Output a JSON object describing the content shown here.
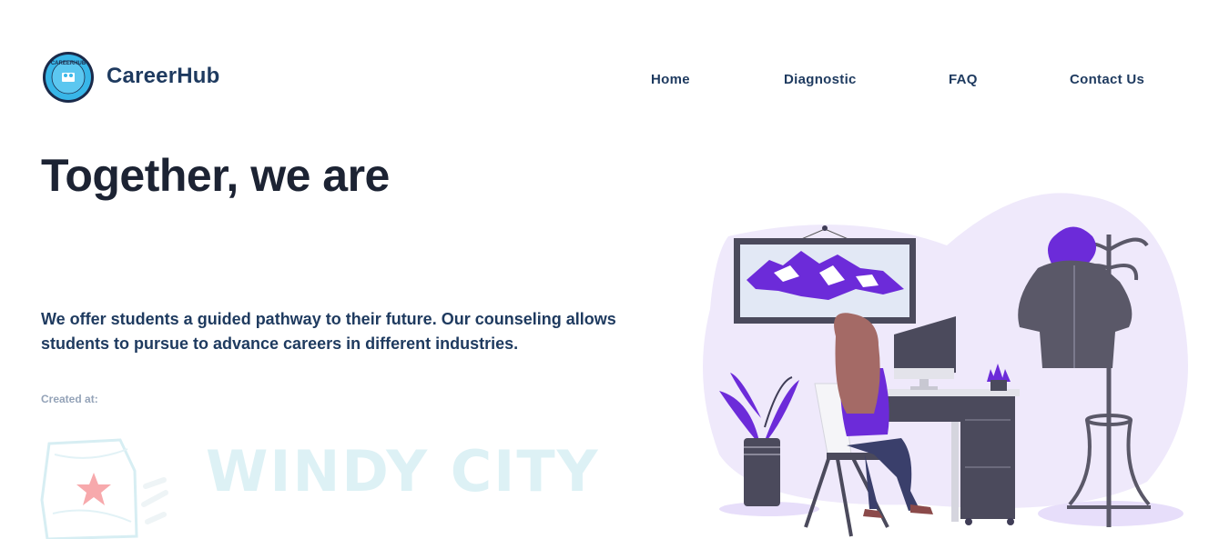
{
  "header": {
    "brand": "CareerHub",
    "logo_text": "CAREERHUB"
  },
  "nav": {
    "items": [
      "Home",
      "Diagnostic",
      "FAQ",
      "Contact Us"
    ]
  },
  "hero": {
    "headline": "Together, we are",
    "description": "We offer students a guided pathway to their future. Our counseling allows students to pursue to advance careers in different industries.",
    "created_label": "Created at:",
    "sponsor_logo_text": "WINDY CITY"
  },
  "colors": {
    "brand_navy": "#1e3a5f",
    "accent_purple": "#6c2bd9",
    "blob_lavender": "#efe9fb",
    "logo_blue": "#38b6e8"
  }
}
